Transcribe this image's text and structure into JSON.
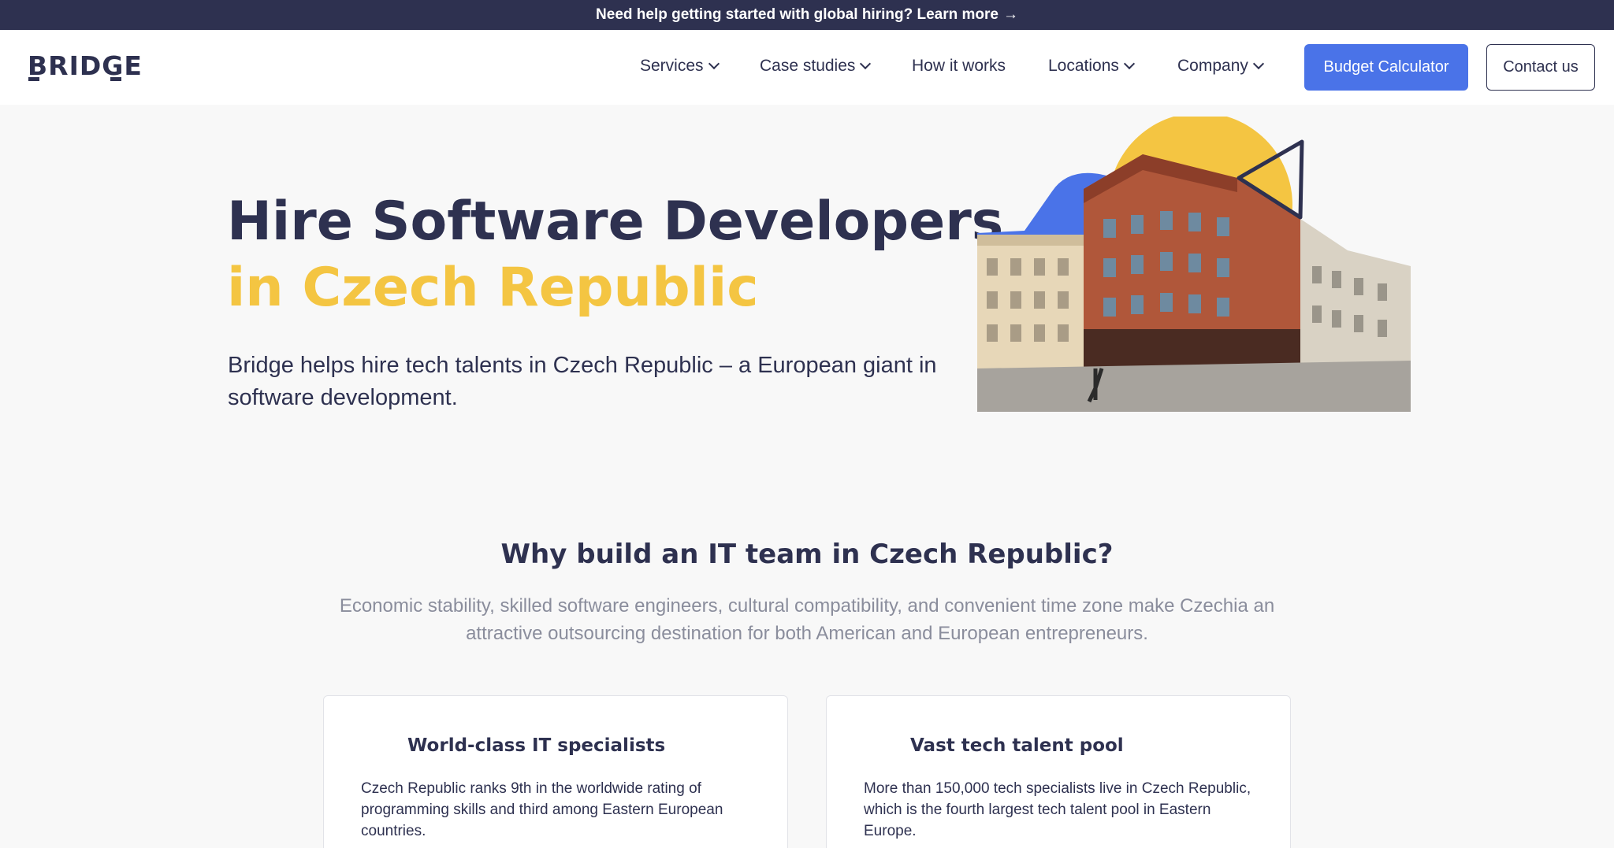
{
  "announcement": {
    "text": "Need help getting started with global hiring? Learn more",
    "arrow": "→"
  },
  "header": {
    "logo": "BRIDGE",
    "nav": [
      {
        "label": "Services",
        "dropdown": true
      },
      {
        "label": "Case studies",
        "dropdown": true
      },
      {
        "label": "How it works",
        "dropdown": false
      },
      {
        "label": "Locations",
        "dropdown": true
      },
      {
        "label": "Company",
        "dropdown": true
      }
    ],
    "cta_primary": "Budget Calculator",
    "cta_secondary": "Contact us"
  },
  "hero": {
    "title_line1": "Hire Software Developers",
    "title_line2": "in Czech Republic",
    "subtitle": "Bridge helps hire tech talents in Czech Republic – a European giant in software development."
  },
  "why": {
    "title": "Why build an IT team in Czech Republic?",
    "subtitle": "Economic stability, skilled software engineers, cultural compatibility, and convenient time zone make Czechia an attractive outsourcing destination for both American and European entrepreneurs.",
    "cards": [
      {
        "title": "World-class IT specialists",
        "text": "Czech Republic ranks 9th in the worldwide rating of programming skills and third among Eastern European countries."
      },
      {
        "title": "Vast tech talent pool",
        "text": "More than 150,000 tech specialists live in Czech Republic, which is the fourth largest tech talent pool in Eastern Europe."
      }
    ]
  },
  "colors": {
    "navy": "#2e3150",
    "yellow": "#f4c542",
    "blue": "#4a73e8",
    "muted": "#8a8d9c"
  }
}
